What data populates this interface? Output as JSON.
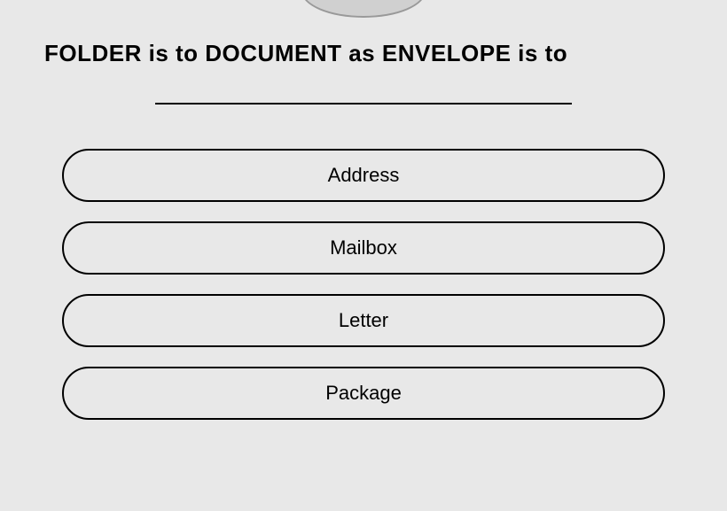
{
  "question": {
    "prompt": "FOLDER is to DOCUMENT as ENVELOPE is to"
  },
  "options": [
    {
      "label": "Address"
    },
    {
      "label": "Mailbox"
    },
    {
      "label": "Letter"
    },
    {
      "label": "Package"
    }
  ]
}
